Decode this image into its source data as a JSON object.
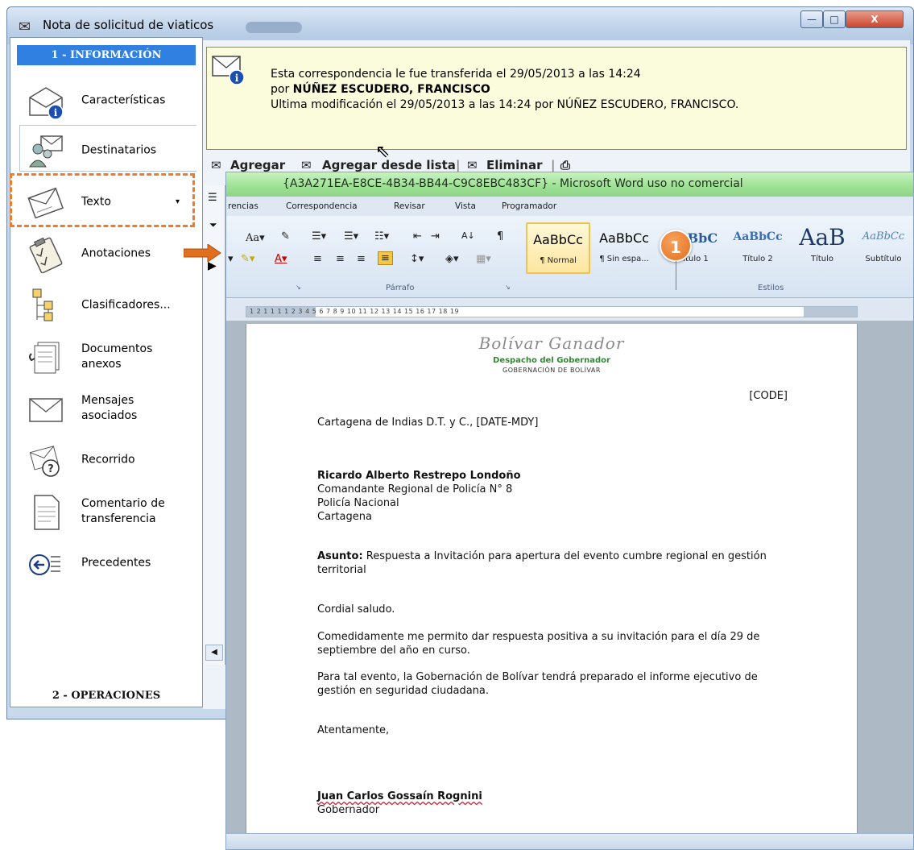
{
  "window": {
    "title": "Nota de solicitud de viaticos",
    "controls": {
      "minimize": "—",
      "maximize": "□",
      "close": "X"
    }
  },
  "nav": {
    "header": "1 - INFORMACIÓN",
    "footer": "2 - OPERACIONES",
    "items": [
      {
        "label": "Características",
        "icon": "envelope-info-icon"
      },
      {
        "label": "Destinatarios",
        "icon": "recipients-icon"
      },
      {
        "label": "Texto",
        "icon": "letter-text-icon"
      },
      {
        "label": "Anotaciones",
        "icon": "clipboard-icon"
      },
      {
        "label": "Clasificadores...",
        "icon": "classifier-tree-icon"
      },
      {
        "label": "Documentos\nanexos",
        "icon": "attached-documents-icon"
      },
      {
        "label": "Mensajes\nasociados",
        "icon": "envelope-icon"
      },
      {
        "label": "Recorrido",
        "icon": "route-question-icon"
      },
      {
        "label": "Comentario de\ntransferencia",
        "icon": "document-comment-icon"
      },
      {
        "label": "Precedentes",
        "icon": "back-arrow-icon"
      }
    ],
    "texto_dropdown": "▾"
  },
  "transfer": {
    "line1": "Esta correspondencia le fue transferida el 29/05/2013 a las 14:24",
    "line2_prefix": "por ",
    "line2_name": "NÚÑEZ ESCUDERO, FRANCISCO",
    "line3": "Ultima modificación el 29/05/2013 a las 14:24 por NÚÑEZ ESCUDERO, FRANCISCO."
  },
  "toolbar": {
    "add": "Agregar",
    "add_from_list": "Agregar desde lista",
    "delete": "Eliminar"
  },
  "word": {
    "title": "{A3A271EA-E8CE-4B34-BB44-C9C8EBC483CF} - Microsoft Word uso no comercial",
    "tabs": [
      "rencias",
      "Correspondencia",
      "Revisar",
      "Vista",
      "Programador"
    ],
    "group_paragraph": "Párrafo",
    "group_styles": "Estilos",
    "font_size_btn": "Aa",
    "styles": [
      {
        "sample": "AaBbCc",
        "name": "¶ Normal"
      },
      {
        "sample": "AaBbCc",
        "name": "¶ Sin espa..."
      },
      {
        "sample": "AaBbC",
        "name": "Título 1"
      },
      {
        "sample": "AaBbCc",
        "name": "Título 2"
      },
      {
        "sample": "AaB",
        "name": "Título"
      },
      {
        "sample": "AaBbCc",
        "name": "Subtítulo"
      }
    ],
    "callout_number": "1",
    "ruler_text": "1 2 1 1 1 1 2 3 4 5 6 7 8 9 10 11 12 13 14 15 16 17 18 19"
  },
  "document": {
    "slogan": "Bolívar Ganador",
    "office": "Despacho del Gobernador",
    "government": "GOBERNACIÓN DE BOLÍVAR",
    "code": "[CODE]",
    "place_date": "Cartagena de Indias D.T. y C., [DATE-MDY]",
    "recipient_name": "Ricardo Alberto Restrepo Londoño",
    "recipient_title": "Comandante Regional de Policía N° 8",
    "recipient_org": "Policía Nacional",
    "recipient_city": "Cartagena",
    "subject_label": "Asunto:",
    "subject_text": " Respuesta a Invitación para apertura del evento cumbre regional en gestión territorial",
    "greeting": "Cordial saludo.",
    "paragraph1": "Comedidamente me permito dar respuesta positiva a su invitación para el día 29 de septiembre del año en curso.",
    "paragraph2": "Para tal evento, la Gobernación de Bolívar tendrá preparado el informe ejecutivo de gestión en seguridad ciudadana.",
    "closing": "Atentamente,",
    "signer_name": "Juan Carlos Gossaín Rognini",
    "signer_title": "Gobernador"
  },
  "colors": {
    "nav_header": "#2f80e0",
    "highlight_dashed": "#ee7d2a",
    "callout": "#e06f1e",
    "word_title": "#9fe296"
  }
}
